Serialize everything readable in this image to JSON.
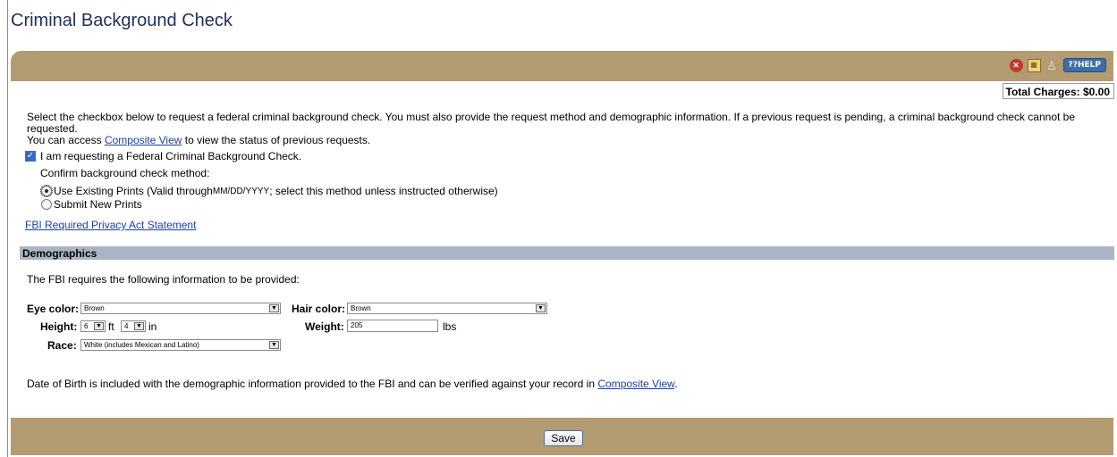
{
  "page": {
    "title": "Criminal Background Check"
  },
  "toolbar": {
    "help_label": "HELP",
    "help_prefix": "?"
  },
  "charges": {
    "label": "Total Charges: $0.00"
  },
  "intro": {
    "text1": "Select the checkbox below to request a federal criminal background check. You must also provide the request method and demographic information. If a previous request is pending, a criminal background check cannot be requested.",
    "text2_prefix": "You can access ",
    "link": "Composite View",
    "text2_suffix": " to view the status of previous requests."
  },
  "request": {
    "checkbox_label": "I am requesting a Federal Criminal Background Check.",
    "checked": true,
    "method_prompt": "Confirm background check method:",
    "option_existing_prefix": "Use Existing Prints (Valid through ",
    "option_existing_date": "MM/DD/YYYY",
    "option_existing_suffix": "; select this method unless instructed otherwise)",
    "option_new": "Submit New Prints",
    "selected": "existing"
  },
  "privacy_link": "FBI Required Privacy Act Statement",
  "demographics": {
    "header": "Demographics",
    "intro": "The FBI requires the following information to be provided:",
    "eye_label": "Eye color:",
    "eye_value": "Brown",
    "hair_label": "Hair color:",
    "hair_value": "Brown",
    "height_label": "Height:",
    "height_ft": "6",
    "ft_label": "ft",
    "height_in": "4",
    "in_label": "in",
    "weight_label": "Weight:",
    "weight_value": "205",
    "lbs_label": "lbs",
    "race_label": "Race:",
    "race_value": "White (includes Mexican and Latino)",
    "dob_prefix": "Date of Birth is included with the demographic information provided to the FBI and can be verified against your record in ",
    "dob_link": "Composite View",
    "dob_suffix": "."
  },
  "footer": {
    "save_label": "Save"
  }
}
